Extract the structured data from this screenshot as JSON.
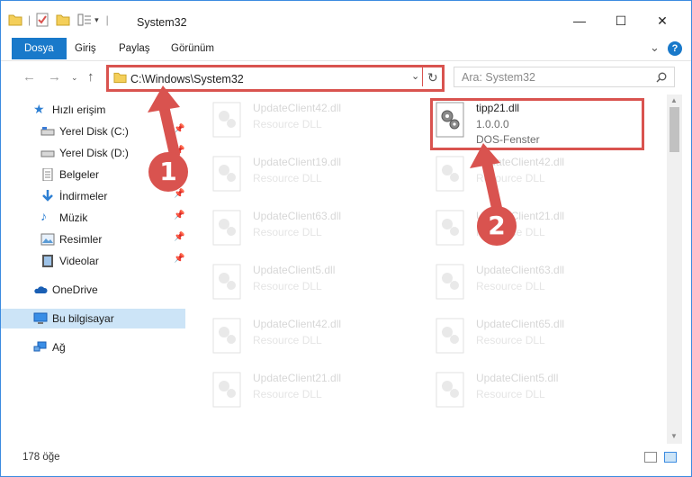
{
  "window": {
    "title": "System32"
  },
  "ribbon": {
    "tabs": [
      {
        "label": "Dosya"
      },
      {
        "label": "Giriş"
      },
      {
        "label": "Paylaş"
      },
      {
        "label": "Görünüm"
      }
    ],
    "help": "?"
  },
  "address": {
    "path": "C:\\Windows\\System32"
  },
  "search": {
    "placeholder": "Ara: System32"
  },
  "sidebar": {
    "quick_access": "Hızlı erişim",
    "items": [
      {
        "label": "Yerel Disk (C:)"
      },
      {
        "label": "Yerel Disk (D:)"
      },
      {
        "label": "Belgeler"
      },
      {
        "label": "İndirmeler"
      },
      {
        "label": "Müzik"
      },
      {
        "label": "Resimler"
      },
      {
        "label": "Videolar"
      }
    ],
    "onedrive": "OneDrive",
    "this_pc": "Bu bilgisayar",
    "network": "Ağ"
  },
  "files": {
    "highlight": {
      "name": "tipp21.dll",
      "version": "1.0.0.0",
      "desc": "DOS-Fenster"
    },
    "left_col": [
      {
        "name": "UpdateClient42.dll",
        "desc": "Resource DLL"
      },
      {
        "name": "UpdateClient19.dll",
        "desc": "Resource DLL"
      },
      {
        "name": "UpdateClient63.dll",
        "desc": "Resource DLL"
      },
      {
        "name": "UpdateClient5.dll",
        "desc": "Resource DLL"
      },
      {
        "name": "UpdateClient42.dll",
        "desc": "Resource DLL"
      },
      {
        "name": "UpdateClient21.dll",
        "desc": "Resource DLL"
      }
    ],
    "right_col": [
      {
        "name": "UpdateClient42.dll",
        "desc": "Resource DLL"
      },
      {
        "name": "UpdateClient21.dll",
        "desc": "Resource DLL"
      },
      {
        "name": "UpdateClient63.dll",
        "desc": "Resource DLL"
      },
      {
        "name": "UpdateClient65.dll",
        "desc": "Resource DLL"
      },
      {
        "name": "UpdateClient5.dll",
        "desc": "Resource DLL"
      }
    ]
  },
  "status": {
    "count": "178 öğe"
  },
  "annotations": {
    "step1": "1",
    "step2": "2"
  },
  "colors": {
    "accent": "#1979ca",
    "highlight": "#d9534f",
    "selected": "#cce4f7"
  }
}
